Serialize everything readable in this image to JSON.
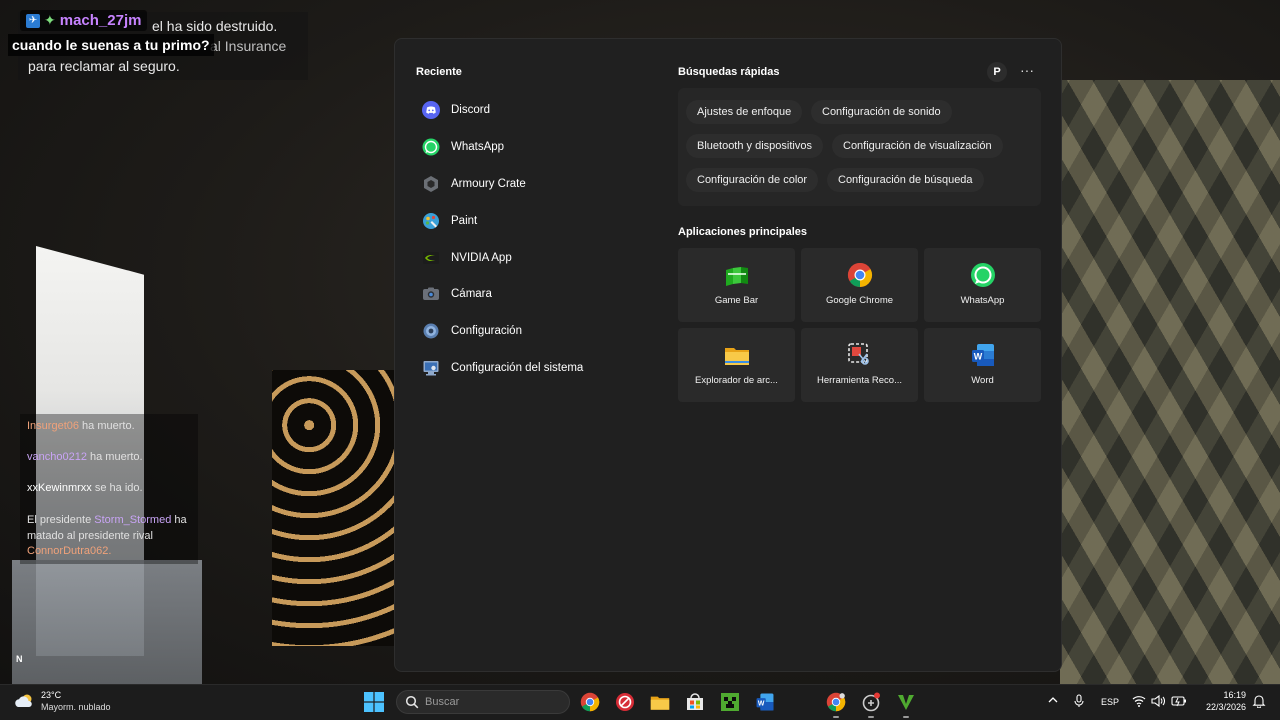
{
  "overlay": {
    "notification": {
      "line1": "el ha sido destruido.",
      "line2": "al Insurance",
      "line3": "para reclamar al seguro."
    },
    "streamer": {
      "name": "mach_27jm",
      "message": "cuando le suenas a tu primo?"
    },
    "killfeed": [
      {
        "name": "Insurget06",
        "text": "ha muerto."
      },
      {
        "name": "vancho0212",
        "text": "ha muerto."
      },
      {
        "name": "xxKewinmrxx",
        "text": "se ha ido."
      }
    ],
    "killfeed_last": {
      "prefix": "El presidente",
      "name": "Storm_Stormed",
      "mid": "ha matado al presidente rival",
      "victim": "ConnorDutra062."
    },
    "minimap_north": "N"
  },
  "start_menu": {
    "recent_title": "Reciente",
    "recent": [
      {
        "label": "Discord",
        "icon": "discord-icon"
      },
      {
        "label": "WhatsApp",
        "icon": "whatsapp-icon"
      },
      {
        "label": "Armoury Crate",
        "icon": "armoury-crate-icon"
      },
      {
        "label": "Paint",
        "icon": "paint-icon"
      },
      {
        "label": "NVIDIA App",
        "icon": "nvidia-icon"
      },
      {
        "label": "Cámara",
        "icon": "camera-icon"
      },
      {
        "label": "Configuración",
        "icon": "settings-icon"
      },
      {
        "label": "Configuración del sistema",
        "icon": "system-settings-icon"
      }
    ],
    "quick_title": "Búsquedas rápidas",
    "profile_initial": "P",
    "more_label": "···",
    "quick_searches": [
      "Ajustes de enfoque",
      "Configuración de sonido",
      "Bluetooth y dispositivos",
      "Configuración de visualización",
      "Configuración de color",
      "Configuración de búsqueda"
    ],
    "apps_title": "Aplicaciones principales",
    "top_apps": [
      {
        "label": "Game Bar",
        "icon": "game-bar-icon"
      },
      {
        "label": "Google Chrome",
        "icon": "chrome-icon"
      },
      {
        "label": "WhatsApp",
        "icon": "whatsapp-icon"
      },
      {
        "label": "Explorador de arc...",
        "icon": "file-explorer-icon"
      },
      {
        "label": "Herramienta Reco...",
        "icon": "snipping-tool-icon"
      },
      {
        "label": "Word",
        "icon": "word-icon"
      }
    ]
  },
  "taskbar": {
    "weather_temp": "23°C",
    "weather_desc": "Mayorm. nublado",
    "search_placeholder": "Buscar",
    "language": "ESP",
    "time": "16:19",
    "date": "22/3/2026"
  },
  "colors": {
    "accent": "#0078d4",
    "menu_bg": "#202020",
    "tile_bg": "#2a2a2a"
  }
}
